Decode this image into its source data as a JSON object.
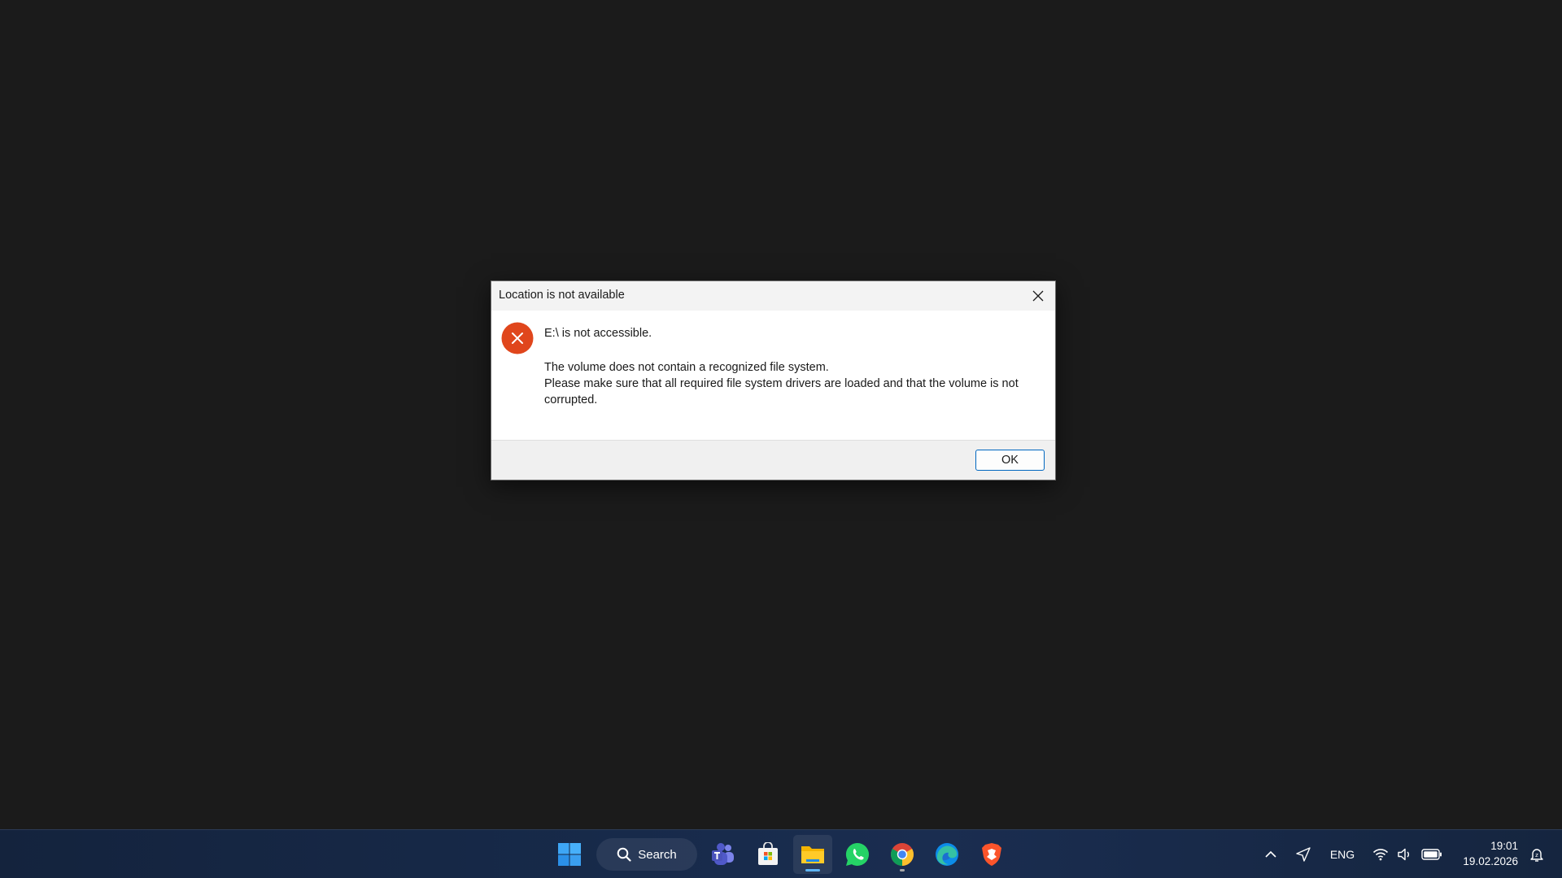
{
  "dialog": {
    "title": "Location is not available",
    "heading": "E:\\ is not accessible.",
    "line1": "The volume does not contain a recognized file system.",
    "line2": "Please make sure that all required file system drivers are loaded and that the volume is not corrupted.",
    "ok_label": "OK",
    "icon": "error-icon",
    "icon_color": "#e0461c"
  },
  "taskbar": {
    "search_label": "Search",
    "apps": [
      "start-icon",
      "teams-icon",
      "microsoft-store-icon",
      "file-explorer-icon",
      "whatsapp-icon",
      "chrome-icon",
      "edge-icon",
      "brave-icon"
    ],
    "active_app": "file-explorer-icon",
    "tray": {
      "language": "ENG",
      "time": "19:01",
      "date": "19.02.2026",
      "icons": [
        "chevron-up-icon",
        "location-icon",
        "wifi-icon",
        "volume-icon",
        "battery-icon",
        "notification-icon"
      ]
    }
  },
  "colors": {
    "accent": "#0067c0",
    "desktop": "#1b1b1b"
  }
}
